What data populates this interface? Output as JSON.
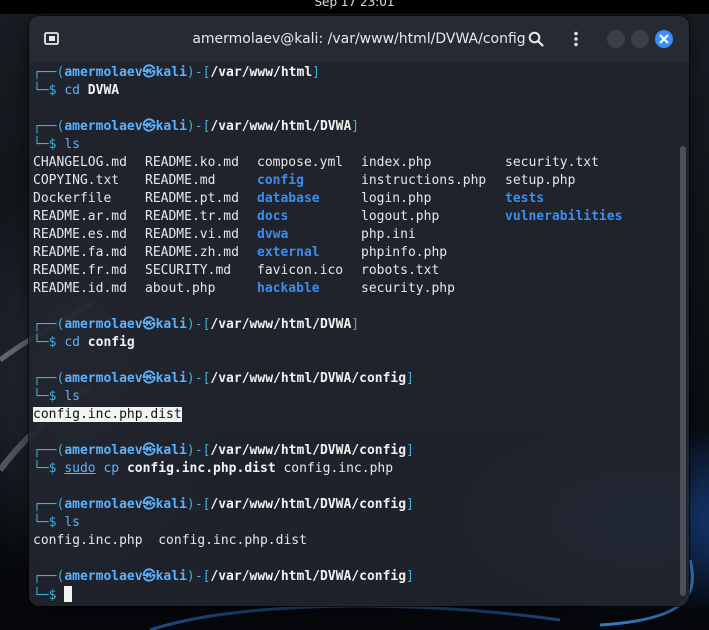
{
  "topbar": {
    "clock": "Sep 17  23:01"
  },
  "window": {
    "title": "amermolaev@kali: /var/www/html/DVWA/config"
  },
  "prompt": {
    "user": "amermolaev",
    "at": "㉿",
    "host": "kali"
  },
  "blocks": [
    {
      "path": "/var/www/html",
      "cmd": [
        {
          "t": "cd",
          "k": "verb"
        },
        {
          "t": " "
        },
        {
          "t": "DVWA",
          "k": "arg"
        }
      ]
    },
    {
      "path": "/var/www/html/DVWA",
      "cmd": [
        {
          "t": "ls",
          "k": "verb"
        }
      ]
    },
    {
      "path": "/var/www/html/DVWA",
      "cmd": [
        {
          "t": "cd",
          "k": "verb"
        },
        {
          "t": " "
        },
        {
          "t": "config",
          "k": "arg"
        }
      ]
    },
    {
      "path": "/var/www/html/DVWA/config",
      "cmd": [
        {
          "t": "ls",
          "k": "verb"
        }
      ]
    },
    {
      "path": "/var/www/html/DVWA/config",
      "cmd": [
        {
          "t": "sudo",
          "k": "sudo"
        },
        {
          "t": " "
        },
        {
          "t": "cp",
          "k": "verb"
        },
        {
          "t": " "
        },
        {
          "t": "config.inc.php.dist",
          "k": "arg"
        },
        {
          "t": " config.inc.php"
        }
      ]
    },
    {
      "path": "/var/www/html/DVWA/config",
      "cmd": [
        {
          "t": "ls",
          "k": "verb"
        }
      ]
    },
    {
      "path": "/var/www/html/DVWA/config",
      "cmd": []
    }
  ],
  "ls_dvwa": [
    [
      {
        "t": "CHANGELOG.md"
      },
      {
        "t": "COPYING.txt"
      },
      {
        "t": "Dockerfile"
      },
      {
        "t": "README.ar.md"
      },
      {
        "t": "README.es.md"
      },
      {
        "t": "README.fa.md"
      },
      {
        "t": "README.fr.md"
      },
      {
        "t": "README.id.md"
      }
    ],
    [
      {
        "t": "README.ko.md"
      },
      {
        "t": "README.md"
      },
      {
        "t": "README.pt.md"
      },
      {
        "t": "README.tr.md"
      },
      {
        "t": "README.vi.md"
      },
      {
        "t": "README.zh.md"
      },
      {
        "t": "SECURITY.md"
      },
      {
        "t": "about.php"
      }
    ],
    [
      {
        "t": "compose.yml"
      },
      {
        "t": "config",
        "dir": true
      },
      {
        "t": "database",
        "dir": true
      },
      {
        "t": "docs",
        "dir": true
      },
      {
        "t": "dvwa",
        "dir": true
      },
      {
        "t": "external",
        "dir": true
      },
      {
        "t": "favicon.ico"
      },
      {
        "t": "hackable",
        "dir": true
      }
    ],
    [
      {
        "t": "index.php"
      },
      {
        "t": "instructions.php"
      },
      {
        "t": "login.php"
      },
      {
        "t": "logout.php"
      },
      {
        "t": "php.ini"
      },
      {
        "t": "phpinfo.php"
      },
      {
        "t": "robots.txt"
      },
      {
        "t": "security.php"
      }
    ],
    [
      {
        "t": "security.txt"
      },
      {
        "t": "setup.php"
      },
      {
        "t": "tests",
        "dir": true
      },
      {
        "t": "vulnerabilities",
        "dir": true
      }
    ]
  ],
  "ls_config_1": "config.inc.php.dist",
  "ls_config_2": "config.inc.php  config.inc.php.dist",
  "colors": {
    "accent": "#3d8ef7",
    "prompt_user": "#5cb2ff",
    "directory": "#3a8ef0"
  },
  "icons": {
    "new_tab": "new-tab-icon",
    "search": "search-icon",
    "menu": "menu-icon",
    "close": "close-icon"
  }
}
